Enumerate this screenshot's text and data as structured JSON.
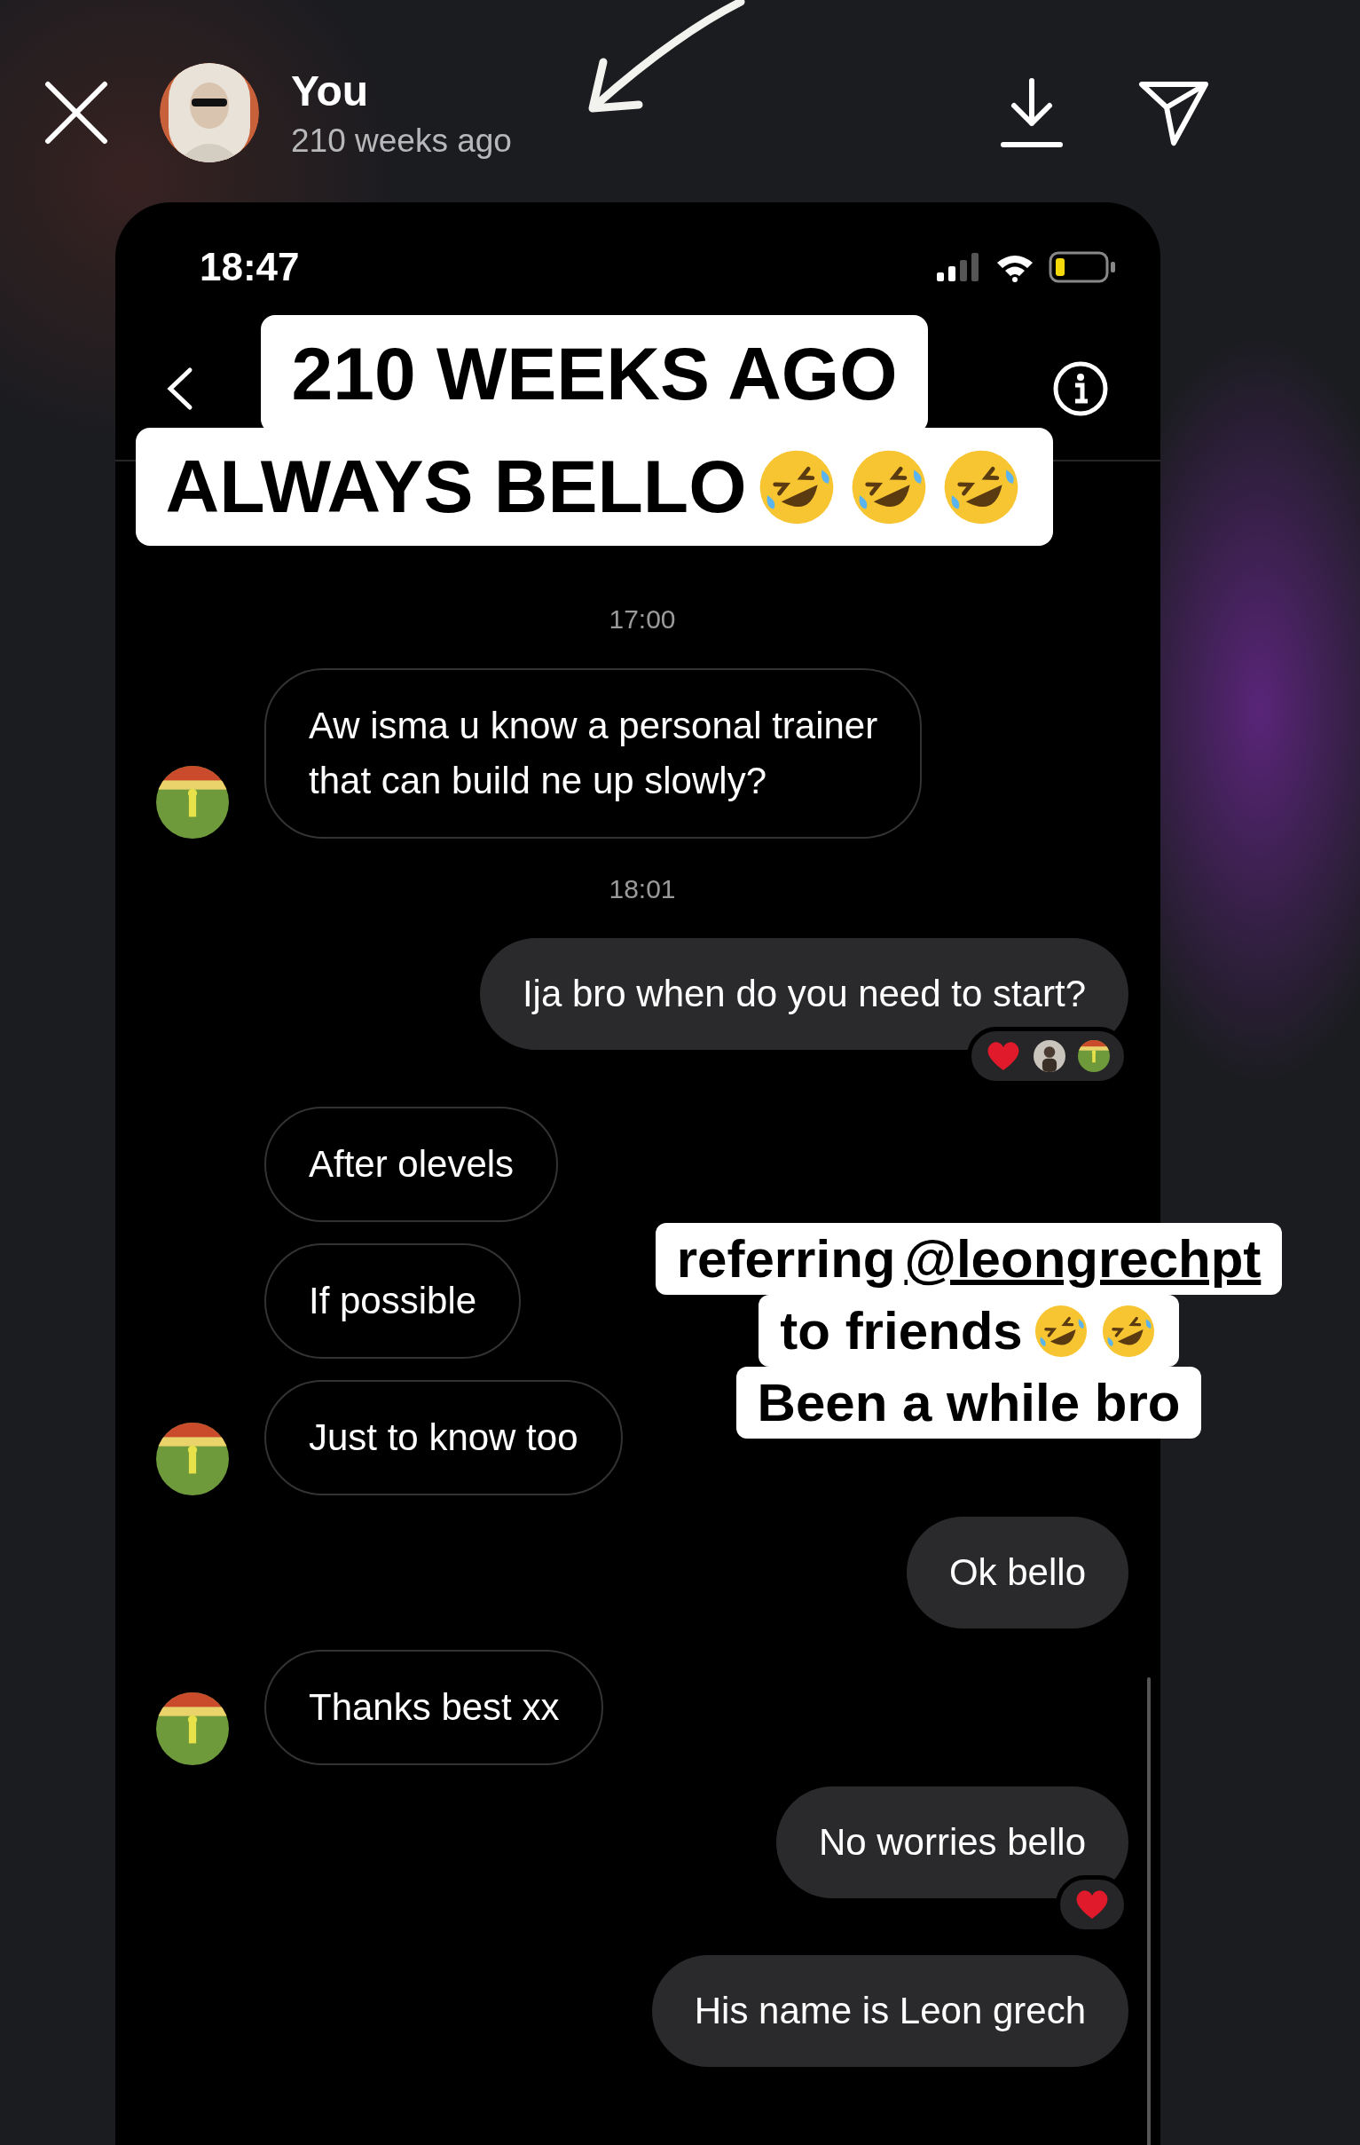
{
  "story": {
    "user": "You",
    "time": "210 weeks ago"
  },
  "phone": {
    "status_time": "18:47"
  },
  "messages": [
    {
      "kind": "timestamp",
      "text": "17:00"
    },
    {
      "kind": "incoming",
      "text": "Aw isma u know a personal trainer\nthat can build ne up slowly?",
      "avatar": true
    },
    {
      "kind": "timestamp",
      "text": "18:01"
    },
    {
      "kind": "outgoing",
      "text": "Ija bro when do you need to start?",
      "reactions": [
        {
          "kind": "heart"
        },
        {
          "kind": "dark_avatar"
        },
        {
          "kind": "green_avatar"
        }
      ]
    },
    {
      "kind": "incoming",
      "text": "After olevels",
      "avatar": false
    },
    {
      "kind": "incoming",
      "text": "If possible",
      "avatar": false
    },
    {
      "kind": "incoming",
      "text": "Just to know too",
      "avatar": true
    },
    {
      "kind": "outgoing",
      "text": "Ok bello"
    },
    {
      "kind": "incoming",
      "text": "Thanks best xx",
      "avatar": true
    },
    {
      "kind": "outgoing",
      "text": "No worries bello",
      "reactions": [
        {
          "kind": "heart"
        }
      ]
    },
    {
      "kind": "outgoing",
      "text": "His name is Leon grech"
    }
  ],
  "stickers": [
    {
      "kind": "headline",
      "lines": [
        {
          "text": "210 WEEKS AGO"
        },
        {
          "text": "ALWAYS BELLO",
          "emojis": [
            {
              "kind": "rofl"
            },
            {
              "kind": "rofl"
            },
            {
              "kind": "rofl"
            }
          ]
        }
      ]
    },
    {
      "kind": "caption",
      "lines": [
        {
          "text": "referring",
          "mention": "@leongrechpt"
        },
        {
          "text": "to friends",
          "emojis": [
            {
              "kind": "rofl"
            },
            {
              "kind": "rofl"
            }
          ]
        },
        {
          "text": "Been a while bro"
        }
      ]
    }
  ]
}
